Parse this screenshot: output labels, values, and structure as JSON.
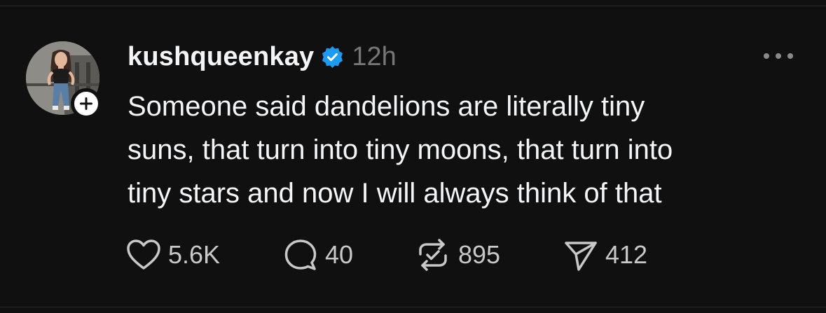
{
  "post": {
    "author": {
      "username": "kushqueenkay",
      "verified": true,
      "verified_color": "#1d9bf0",
      "avatar_icon": "profile-photo",
      "follow_icon": "plus-icon"
    },
    "timestamp": "12h",
    "more_icon": "ellipsis-icon",
    "text_lines": [
      "Someone said dandelions are literally tiny",
      "suns, that turn into tiny moons, that turn into",
      "tiny stars and now I will always think of that"
    ],
    "actions": {
      "like": {
        "icon": "heart-icon",
        "count": "5.6K"
      },
      "reply": {
        "icon": "speech-bubble-icon",
        "count": "40"
      },
      "repost": {
        "icon": "repost-icon",
        "count": "895"
      },
      "share": {
        "icon": "send-icon",
        "count": "412"
      }
    }
  },
  "theme": {
    "background": "#101010",
    "text": "#f3f5f7",
    "muted": "#777777"
  }
}
